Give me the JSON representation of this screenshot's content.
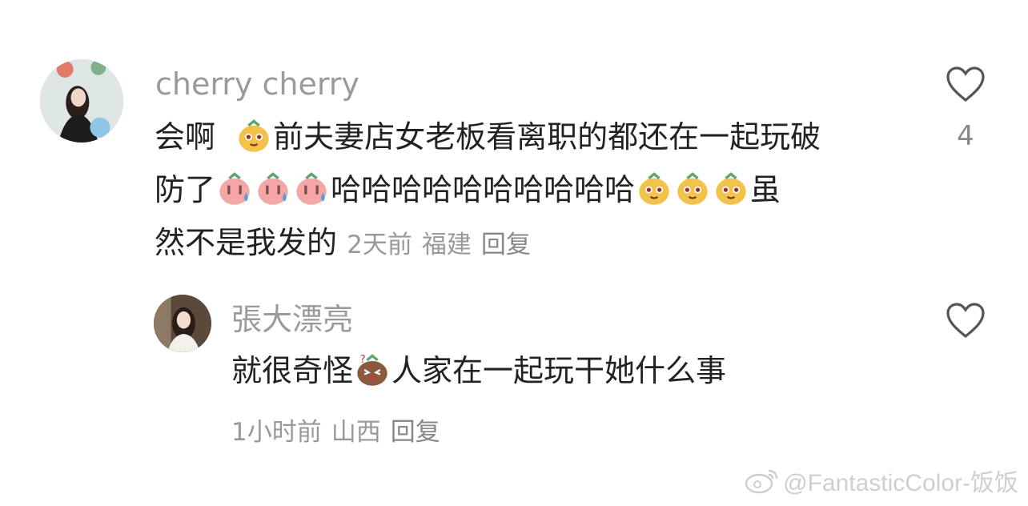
{
  "comment1": {
    "username": "cherry cherry",
    "line1_a": "会啊",
    "line1_b": "前夫妻店女老板看离职的都还在一起玩破",
    "line2_a": "防了",
    "line2_b": "哈哈哈哈哈哈哈哈哈哈",
    "line2_c": "虽",
    "line3": "然不是我发的",
    "time": "2天前",
    "location": "福建",
    "reply": "回复",
    "likes": "4",
    "emoji_names": [
      "cheer-emoji",
      "sweat-peach-emoji",
      "laugh-emoji"
    ]
  },
  "comment2": {
    "username": "張大漂亮",
    "text_a": "就很奇怪",
    "text_b": "人家在一起玩干她什么事",
    "time": "1小时前",
    "location": "山西",
    "reply": "回复",
    "emoji_names": [
      "confused-emoji"
    ]
  },
  "watermark": "@FantasticColor-饭饭",
  "colors": {
    "text": "#222222",
    "meta": "#999999",
    "username": "#9a9a9a"
  }
}
